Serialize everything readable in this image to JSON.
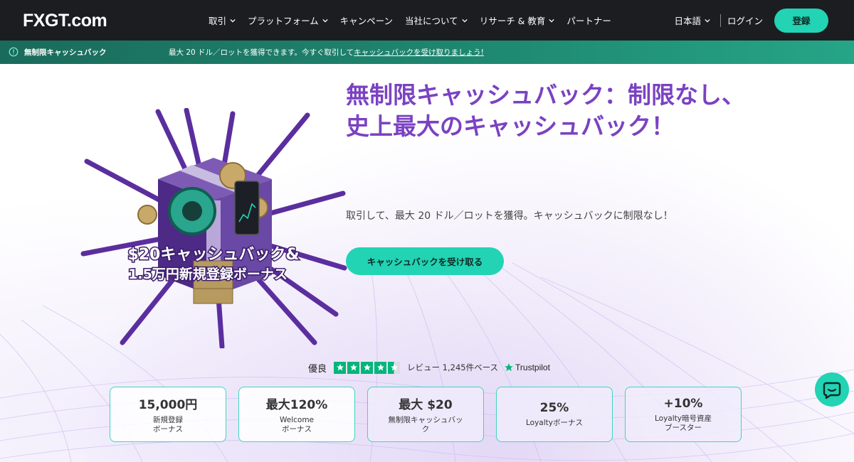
{
  "brand": {
    "logo_text": "FXGT.com"
  },
  "nav": {
    "items": [
      {
        "label": "取引",
        "dropdown": true
      },
      {
        "label": "プラットフォーム",
        "dropdown": true
      },
      {
        "label": "キャンペーン",
        "dropdown": false
      },
      {
        "label": "当社について",
        "dropdown": true
      },
      {
        "label": "リサーチ & 教育",
        "dropdown": true
      },
      {
        "label": "パートナー",
        "dropdown": false
      }
    ],
    "language": "日本語",
    "login": "ログイン",
    "register": "登録"
  },
  "promo": {
    "title": "無制限キャッシュバック",
    "text": "最大 20 ドル／ロットを獲得できます。今すぐ取引して",
    "link": "キャッシュバックを受け取りましょう!"
  },
  "hero": {
    "title": "無制限キャッシュバック：制限なし、史上最大のキャッシュバック！",
    "subtitle": "取引して、最大 20 ドル／ロットを獲得。キャッシュバックに制限なし！",
    "cta": "キャッシュバックを受け取る",
    "art_text_line1": "$20キャッシュバック&",
    "art_text_line2": "1.5万円新規登録ボーナス"
  },
  "trustpilot": {
    "rating_label": "優良",
    "stars": 4.5,
    "reviews": "レビュー 1,245件ベース",
    "brand": "Trustpilot"
  },
  "cards": [
    {
      "value": "15,000円",
      "label": "新規登録\nボーナス"
    },
    {
      "value": "最大120%",
      "label": "Welcome\nボーナス"
    },
    {
      "value": "最大 $20",
      "label": "無制限キャッシュバッ\nク"
    },
    {
      "value": "25%",
      "label": "Loyaltyボーナス"
    },
    {
      "value": "+10%",
      "label": "Loyalty暗号資産\nブースター"
    }
  ],
  "colors": {
    "accent": "#22d3b4",
    "title_purple": "#7a42c2",
    "nav_bg": "#1c1d20"
  }
}
